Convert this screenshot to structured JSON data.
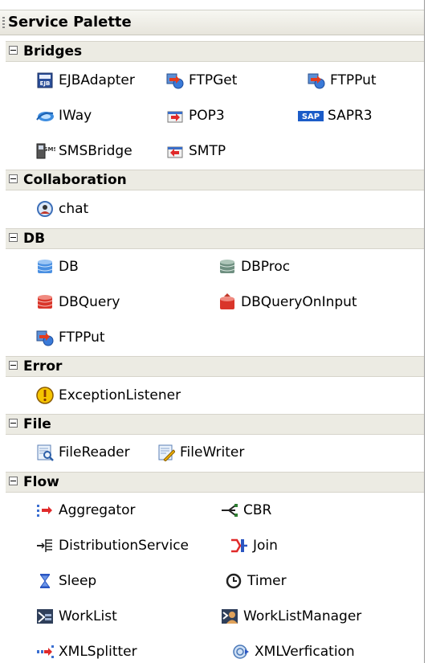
{
  "panel": {
    "title": "Service Palette"
  },
  "categories": [
    {
      "label": "Bridges",
      "items": [
        {
          "label": "EJBAdapter",
          "icon": "ejb-icon"
        },
        {
          "label": "FTPGet",
          "icon": "ftp-icon"
        },
        {
          "label": "FTPPut",
          "icon": "ftp-icon"
        },
        {
          "label": "IWay",
          "icon": "iway-icon"
        },
        {
          "label": "POP3",
          "icon": "mail-icon"
        },
        {
          "label": "SAPR3",
          "icon": "sap-icon"
        },
        {
          "label": "SMSBridge",
          "icon": "sms-icon"
        },
        {
          "label": "SMTP",
          "icon": "mail-icon"
        }
      ]
    },
    {
      "label": "Collaboration",
      "items": [
        {
          "label": "chat",
          "icon": "chat-icon"
        }
      ]
    },
    {
      "label": "DB",
      "items": [
        {
          "label": "DB",
          "icon": "database-icon"
        },
        {
          "label": "DBProc",
          "icon": "database-icon"
        },
        {
          "label": "DBQuery",
          "icon": "database-icon"
        },
        {
          "label": "DBQueryOnInput",
          "icon": "database-icon"
        },
        {
          "label": "FTPPut",
          "icon": "ftp-icon"
        }
      ]
    },
    {
      "label": "Error",
      "items": [
        {
          "label": "ExceptionListener",
          "icon": "warning-icon"
        }
      ]
    },
    {
      "label": "File",
      "items": [
        {
          "label": "FileReader",
          "icon": "file-read-icon"
        },
        {
          "label": "FileWriter",
          "icon": "file-write-icon"
        }
      ]
    },
    {
      "label": "Flow",
      "items": [
        {
          "label": "Aggregator",
          "icon": "aggregator-icon"
        },
        {
          "label": "CBR",
          "icon": "cbr-icon"
        },
        {
          "label": "DistributionService",
          "icon": "distribution-icon"
        },
        {
          "label": "Join",
          "icon": "join-icon"
        },
        {
          "label": "Sleep",
          "icon": "hourglass-icon"
        },
        {
          "label": "Timer",
          "icon": "clock-icon"
        },
        {
          "label": "WorkList",
          "icon": "worklist-icon"
        },
        {
          "label": "WorkListManager",
          "icon": "worklist-manager-icon"
        },
        {
          "label": "XMLSplitter",
          "icon": "splitter-icon"
        },
        {
          "label": "XMLVerfication",
          "icon": "xml-verify-icon"
        }
      ]
    }
  ]
}
